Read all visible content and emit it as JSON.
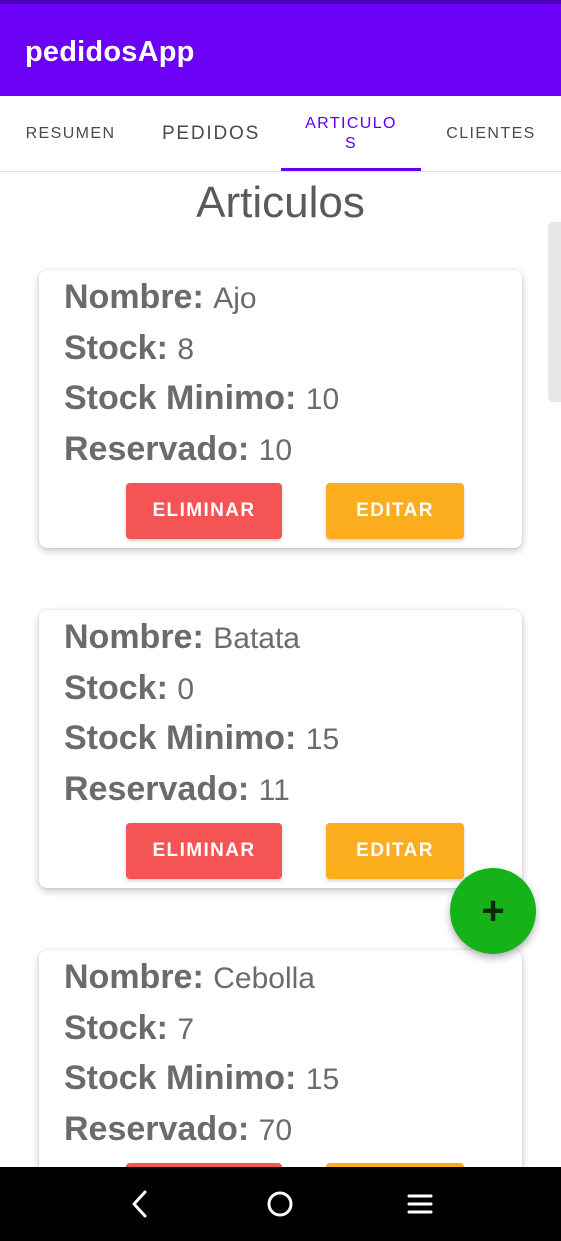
{
  "app": {
    "title": "pedidosApp"
  },
  "tabs": [
    {
      "label": "RESUMEN"
    },
    {
      "label": "PEDIDOS"
    },
    {
      "label": "ARTICULOS",
      "active": true
    },
    {
      "label": "CLIENTES"
    }
  ],
  "page": {
    "title": "Articulos"
  },
  "labels": {
    "nombre": "Nombre:",
    "stock": "Stock:",
    "stock_minimo": "Stock Minimo:",
    "reservado": "Reservado:",
    "eliminar": "ELIMINAR",
    "editar": "EDITAR"
  },
  "articles": [
    {
      "nombre": "Ajo",
      "stock": "8",
      "stock_minimo": "10",
      "reservado": "10"
    },
    {
      "nombre": "Batata",
      "stock": "0",
      "stock_minimo": "15",
      "reservado": "11"
    },
    {
      "nombre": "Cebolla",
      "stock": "7",
      "stock_minimo": "15",
      "reservado": "70"
    }
  ],
  "fab": {
    "label": "+",
    "icon": "plus-icon"
  },
  "colors": {
    "primary": "#6a00f4",
    "tab_active": "#6200ee",
    "delete": "#f55454",
    "edit": "#fbad1e",
    "fab": "#16b21a"
  },
  "navbar": {
    "icons": [
      "back-icon",
      "home-icon",
      "menu-icon"
    ]
  }
}
